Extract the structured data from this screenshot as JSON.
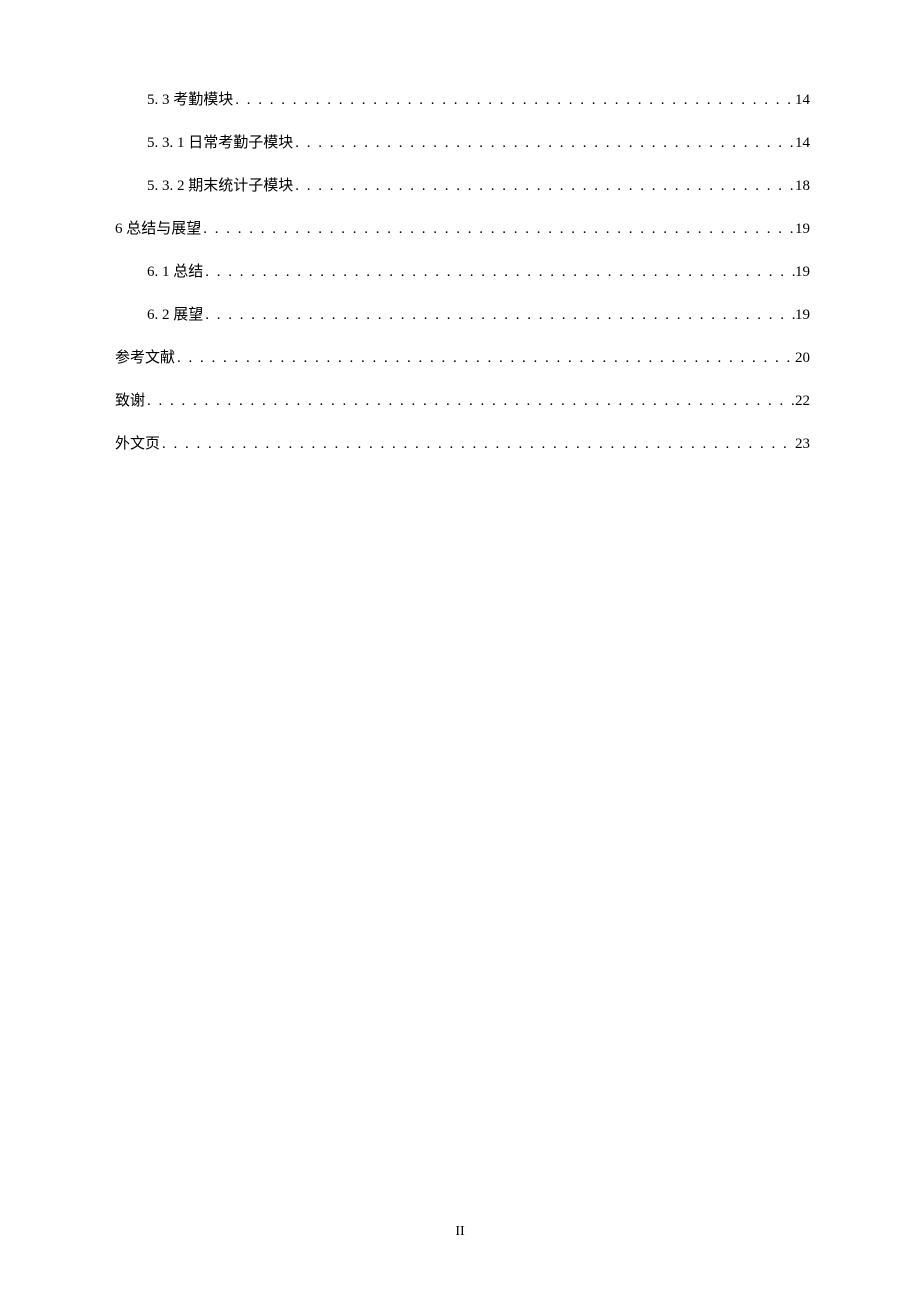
{
  "toc": {
    "entries": [
      {
        "label": "5. 3 考勤模块",
        "page": "14",
        "indent": 1
      },
      {
        "label": "5. 3. 1 日常考勤子模块",
        "page": "14",
        "indent": 1
      },
      {
        "label": "5. 3. 2 期末统计子模块",
        "page": "18",
        "indent": 1
      },
      {
        "label": "6  总结与展望",
        "page": "19",
        "indent": 0
      },
      {
        "label": "6. 1 总结",
        "page": "19",
        "indent": 1
      },
      {
        "label": "6. 2 展望",
        "page": "19",
        "indent": 1
      },
      {
        "label": "参考文献",
        "page": "20",
        "indent": 0
      },
      {
        "label": "致谢",
        "page": "22",
        "indent": 0
      },
      {
        "label": "外文页",
        "page": "23",
        "indent": 0
      }
    ]
  },
  "page_number": "II"
}
